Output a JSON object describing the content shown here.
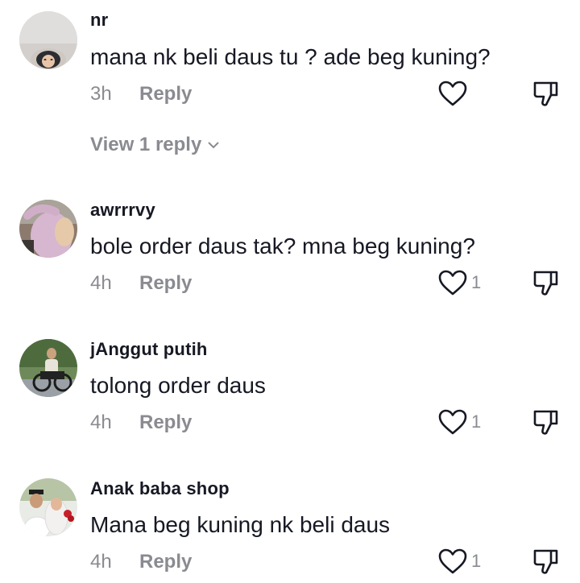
{
  "comments": [
    {
      "username": "nr",
      "text": "mana nk beli daus tu ? ade beg kuning?",
      "time": "3h",
      "reply_label": "Reply",
      "like_count": "",
      "view_replies": "View 1 reply"
    },
    {
      "username": "awrrrvy",
      "text": "bole order daus tak? mna beg kuning?",
      "time": "4h",
      "reply_label": "Reply",
      "like_count": "1"
    },
    {
      "username": "jAnggut putih",
      "text": "tolong order daus",
      "time": "4h",
      "reply_label": "Reply",
      "like_count": "1"
    },
    {
      "username": "Anak baba shop",
      "text": "Mana beg kuning nk beli daus",
      "time": "4h",
      "reply_label": "Reply",
      "like_count": "1"
    }
  ],
  "icons": {
    "like": "heart-outline-icon",
    "dislike": "thumbs-down-icon",
    "expand": "chevron-down-icon"
  },
  "colors": {
    "primary_text": "#161823",
    "secondary_text": "#8a8b91"
  }
}
